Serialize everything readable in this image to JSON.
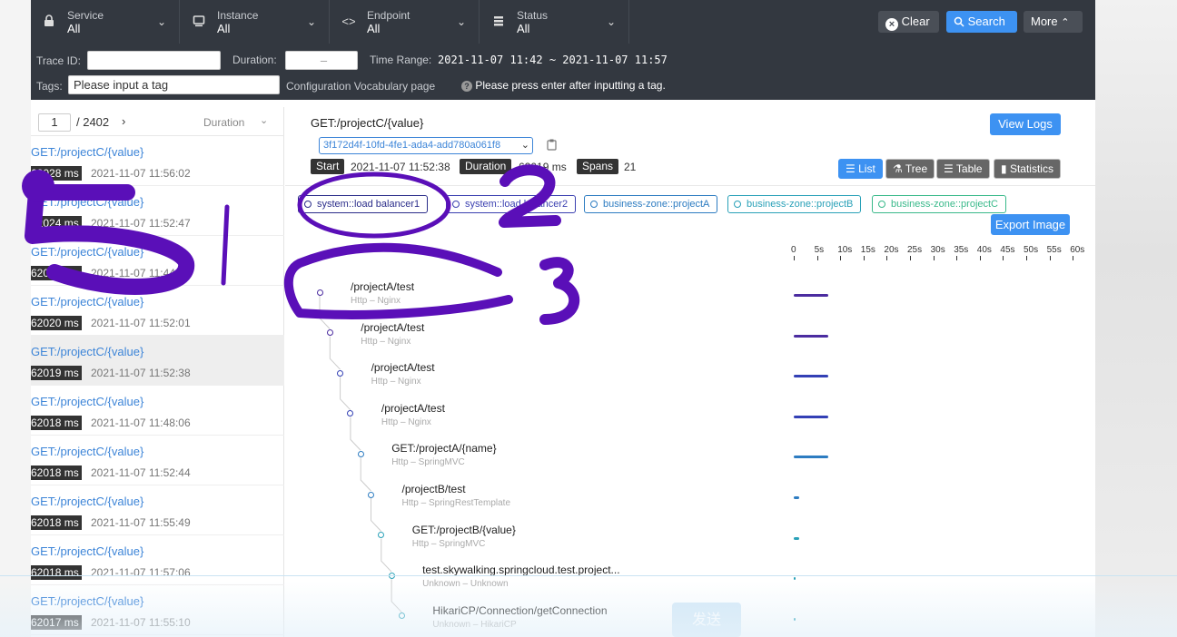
{
  "filters": [
    {
      "label": "Service",
      "value": "All",
      "icon": "lock-icon"
    },
    {
      "label": "Instance",
      "value": "All",
      "icon": "monitor-icon"
    },
    {
      "label": "Endpoint",
      "value": "All",
      "icon": "code-icon"
    },
    {
      "label": "Status",
      "value": "All",
      "icon": "database-icon"
    }
  ],
  "buttons": {
    "clear": "Clear",
    "search": "Search",
    "more": "More"
  },
  "search": {
    "trace_id_label": "Trace ID:",
    "duration_label": "Duration:",
    "duration_value": "–",
    "time_range_label": "Time Range:",
    "time_range_value": "2021-11-07 11:42 ~ 2021-11-07 11:57",
    "tags_label": "Tags:",
    "tags_placeholder": "Please input a tag",
    "vocab_link": "Configuration Vocabulary page",
    "tags_hint": "Please press enter after inputting a tag."
  },
  "pager": {
    "page": "1",
    "total": "/ 2402",
    "sort": "Duration"
  },
  "traces": [
    {
      "endpoint": "GET:/projectC/{value}",
      "duration": "62028 ms",
      "time": "2021-11-07 11:56:02"
    },
    {
      "endpoint": "GET:/projectC/{value}",
      "duration": "62024 ms",
      "time": "2021-11-07 11:52:47"
    },
    {
      "endpoint": "GET:/projectC/{value}",
      "duration": "62023 ms",
      "time": "2021-11-07 11:44:50"
    },
    {
      "endpoint": "GET:/projectC/{value}",
      "duration": "62020 ms",
      "time": "2021-11-07 11:52:01"
    },
    {
      "endpoint": "GET:/projectC/{value}",
      "duration": "62019 ms",
      "time": "2021-11-07 11:52:38"
    },
    {
      "endpoint": "GET:/projectC/{value}",
      "duration": "62018 ms",
      "time": "2021-11-07 11:48:06"
    },
    {
      "endpoint": "GET:/projectC/{value}",
      "duration": "62018 ms",
      "time": "2021-11-07 11:52:44"
    },
    {
      "endpoint": "GET:/projectC/{value}",
      "duration": "62018 ms",
      "time": "2021-11-07 11:55:49"
    },
    {
      "endpoint": "GET:/projectC/{value}",
      "duration": "62018 ms",
      "time": "2021-11-07 11:57:06"
    },
    {
      "endpoint": "GET:/projectC/{value}",
      "duration": "62017 ms",
      "time": "2021-11-07 11:55:10"
    }
  ],
  "detail": {
    "title": "GET:/projectC/{value}",
    "view_logs": "View Logs",
    "trace_id": "3f172d4f-10fd-4fe1-ada4-add780a061f8",
    "start_label": "Start",
    "start_value": "2021-11-07 11:52:38",
    "duration_label": "Duration",
    "duration_value": "62019 ms",
    "spans_label": "Spans",
    "spans_value": "21",
    "views": [
      "List",
      "Tree",
      "Table",
      "Statistics"
    ],
    "export": "Export Image"
  },
  "services": [
    {
      "name": "system::load balancer1",
      "color": "#2b2d8a"
    },
    {
      "name": "system::load balancer2",
      "color": "#3a3fb0"
    },
    {
      "name": "business-zone::projectA",
      "color": "#2d7cc1"
    },
    {
      "name": "business-zone::projectB",
      "color": "#2aa1b8"
    },
    {
      "name": "business-zone::projectC",
      "color": "#39b98a"
    }
  ],
  "axis_ticks": [
    "0",
    "5s",
    "10s",
    "15s",
    "20s",
    "25s",
    "30s",
    "35s",
    "40s",
    "45s",
    "50s",
    "55s",
    "60s"
  ],
  "spans": [
    {
      "name": "/projectA/test",
      "sub": "Http – Nginx",
      "color": "#4b2ca0"
    },
    {
      "name": "/projectA/test",
      "sub": "Http – Nginx",
      "color": "#4b2ca0"
    },
    {
      "name": "/projectA/test",
      "sub": "Http – Nginx",
      "color": "#3340b5"
    },
    {
      "name": "/projectA/test",
      "sub": "Http – Nginx",
      "color": "#3340b5"
    },
    {
      "name": "GET:/projectA/{name}",
      "sub": "Http – SpringMVC",
      "color": "#2d7cc1"
    },
    {
      "name": "/projectB/test",
      "sub": "Http – SpringRestTemplate",
      "color": "#2d7cc1"
    },
    {
      "name": "GET:/projectB/{value}",
      "sub": "Http – SpringMVC",
      "color": "#2aa1b8"
    },
    {
      "name": "test.skywalking.springcloud.test.project...",
      "sub": "Unknown – Unknown",
      "color": "#2aa1b8"
    },
    {
      "name": "HikariCP/Connection/getConnection",
      "sub": "Unknown – HikariCP",
      "color": "#2aa1b8"
    }
  ],
  "send": "发送",
  "annotations": [
    "5",
    "|",
    "2",
    "3"
  ]
}
